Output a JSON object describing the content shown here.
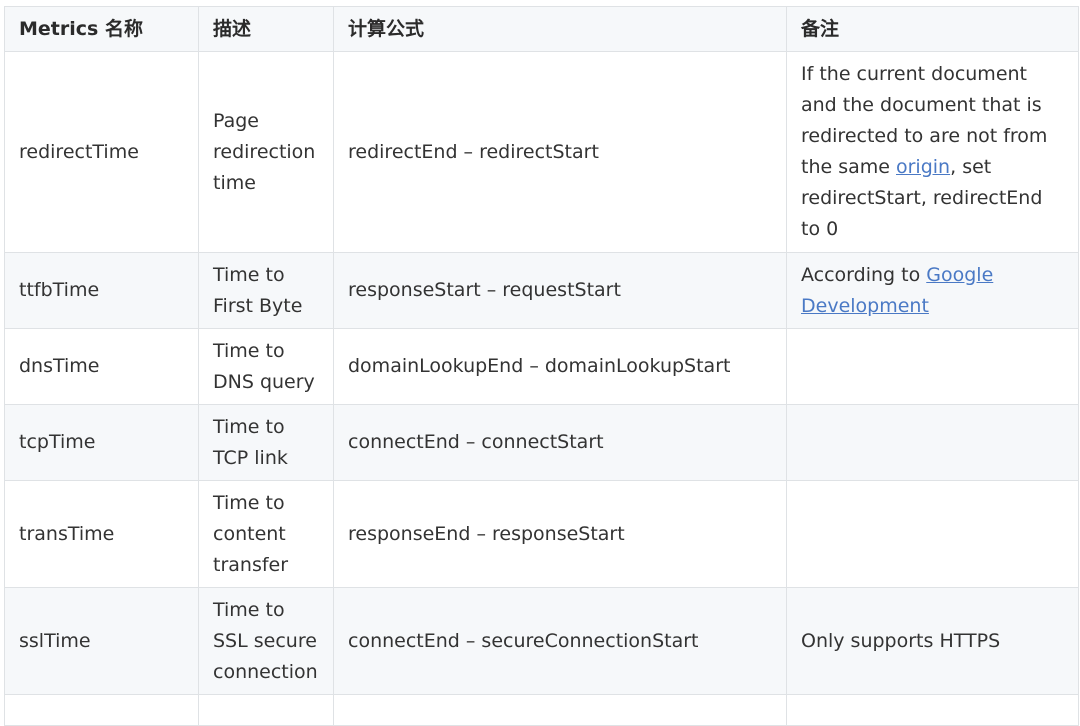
{
  "table": {
    "headers": [
      "Metrics 名称",
      "描述",
      "计算公式",
      "备注"
    ],
    "rows": [
      {
        "metric": "redirectTime",
        "description": "Page redirection time",
        "formula": "redirectEnd – redirectStart",
        "note_before": "If the current document and the document that is redirected to are not from the same ",
        "note_link": "origin",
        "note_after": ", set redirectStart, redirectEnd to 0"
      },
      {
        "metric": "ttfbTime",
        "description": "Time to First Byte",
        "formula": "responseStart – requestStart",
        "note_before": "According to ",
        "note_link": "Google Development",
        "note_after": ""
      },
      {
        "metric": "dnsTime",
        "description": "Time to DNS query",
        "formula": "domainLookupEnd – domainLookupStart",
        "note": ""
      },
      {
        "metric": "tcpTime",
        "description": "Time to TCP link",
        "formula": "connectEnd – connectStart",
        "note": ""
      },
      {
        "metric": "transTime",
        "description": "Time to content transfer",
        "formula": "responseEnd – responseStart",
        "note": ""
      },
      {
        "metric": "sslTime",
        "description": "Time to SSL secure connection",
        "formula": "connectEnd – secureConnectionStart",
        "note": "Only supports HTTPS"
      }
    ]
  },
  "colors": {
    "link": "#4a79c5",
    "border": "#dfe2e5",
    "stripe": "#f6f8fa",
    "text": "#333333"
  }
}
